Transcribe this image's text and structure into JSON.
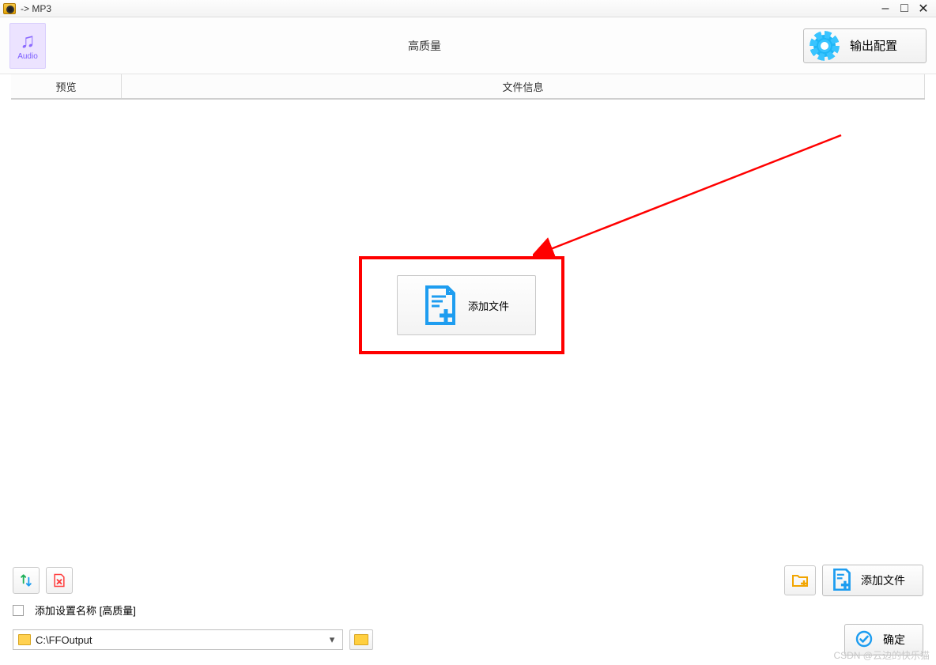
{
  "window": {
    "title": "-> MP3"
  },
  "toolbar": {
    "format_label": "Audio",
    "quality_label": "高质量",
    "output_config_label": "输出配置"
  },
  "tabs": {
    "preview": "预览",
    "file_info": "文件信息"
  },
  "center": {
    "add_file_label": "添加文件"
  },
  "bottom": {
    "add_setting_name_label": "添加设置名称 [高质量]",
    "output_path": "C:\\FFOutput",
    "add_file_label": "添加文件",
    "confirm_label": "确定"
  },
  "watermark": "CSDN @云边的快乐猫"
}
